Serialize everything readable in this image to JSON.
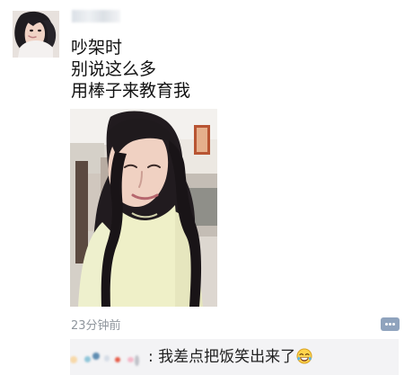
{
  "post": {
    "lines": [
      "吵架时",
      "别说这么多",
      "用棒子来教育我"
    ],
    "time": "23分钟前"
  },
  "comment": {
    "text": ": 我差点把饭笑出来了"
  },
  "icons": {
    "comment_button": "comment-dots-icon",
    "emoji": "tears-of-joy-emoji"
  },
  "colors": {
    "time": "#8f969d",
    "comment_button": "#8fa3bd",
    "comment_background": "#f3f3f5"
  }
}
